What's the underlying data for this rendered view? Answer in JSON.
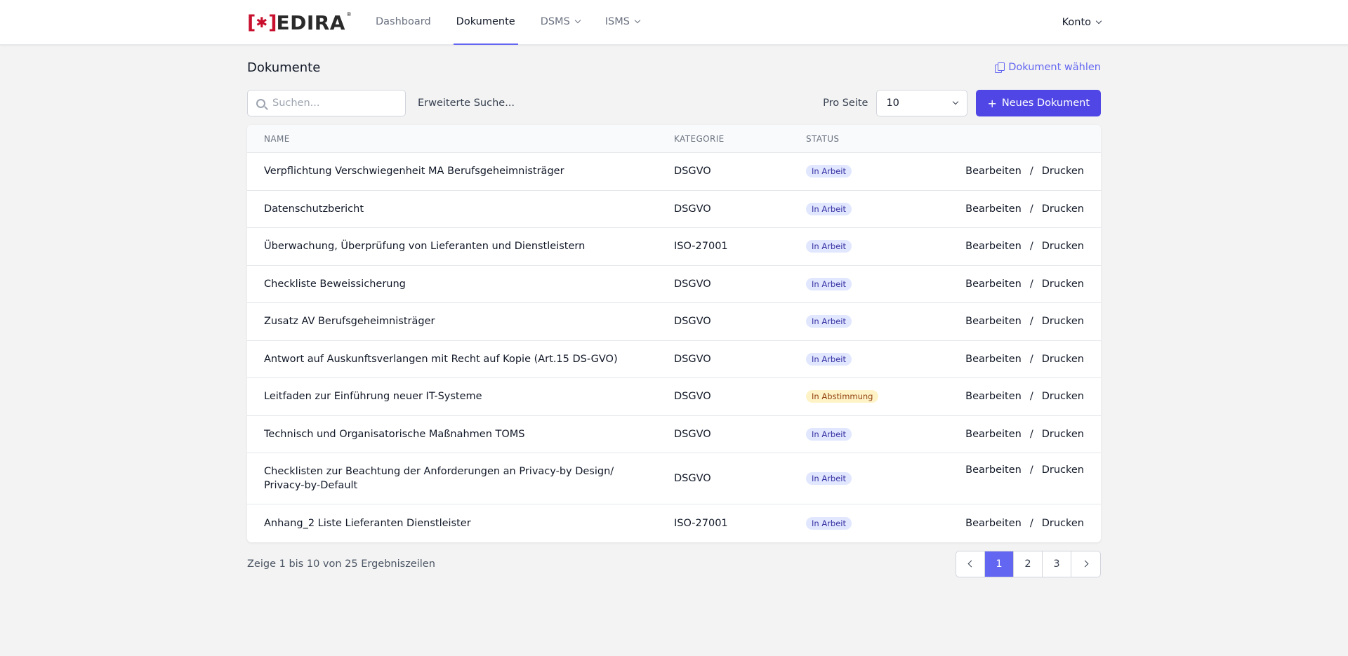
{
  "brand": {
    "bracket_open": "[",
    "bracket_close": "]",
    "star": "✱",
    "name": "EDIRA",
    "reg": "®"
  },
  "nav": {
    "items": [
      {
        "label": "Dashboard"
      },
      {
        "label": "Dokumente"
      },
      {
        "label": "DSMS"
      },
      {
        "label": "ISMS"
      }
    ],
    "account": "Konto"
  },
  "page": {
    "title": "Dokumente",
    "doc_pick": "Dokument wählen"
  },
  "toolbar": {
    "search_placeholder": "Suchen...",
    "advanced_search": "Erweiterte Suche...",
    "per_page_label": "Pro Seite",
    "per_page_value": "10",
    "new_button": "Neues Dokument",
    "new_plus": "+"
  },
  "table": {
    "headers": {
      "name": "NAME",
      "category": "KATEGORIE",
      "status": "STATUS"
    },
    "edit_label": "Bearbeiten",
    "sep": "/",
    "print_label": "Drucken",
    "rows": [
      {
        "name": "Verpflichtung Verschwiegenheit MA Berufsgeheimnisträger",
        "category": "DSGVO",
        "status": "In Arbeit"
      },
      {
        "name": "Datenschutzbericht",
        "category": "DSGVO",
        "status": "In Arbeit"
      },
      {
        "name": "Überwachung, Überprüfung von Lieferanten und Dienstleistern",
        "category": "ISO-27001",
        "status": "In Arbeit"
      },
      {
        "name": "Checkliste Beweissicherung",
        "category": "DSGVO",
        "status": "In Arbeit"
      },
      {
        "name": "Zusatz AV Berufsgeheimnisträger",
        "category": "DSGVO",
        "status": "In Arbeit"
      },
      {
        "name": "Antwort auf Auskunftsverlangen mit Recht auf Kopie (Art.15 DS-GVO)",
        "category": "DSGVO",
        "status": "In Arbeit"
      },
      {
        "name": "Leitfaden zur Einführung neuer IT-Systeme",
        "category": "DSGVO",
        "status": "In Abstimmung"
      },
      {
        "name": "Technisch und Organisatorische Maßnahmen TOMS",
        "category": "DSGVO",
        "status": "In Arbeit"
      },
      {
        "name": "Checklisten zur Beachtung der Anforderungen an Privacy-by Design/ Privacy-by-Default",
        "category": "DSGVO",
        "status": "In Arbeit"
      },
      {
        "name": "Anhang_2 Liste Lieferanten Dienstleister",
        "category": "ISO-27001",
        "status": "In Arbeit"
      }
    ]
  },
  "footer": {
    "results_text": "Zeige 1 bis 10 von 25 Ergebniszeilen",
    "pages": [
      "1",
      "2",
      "3"
    ],
    "current_page": "1"
  },
  "colors": {
    "accent": "#4f46e5",
    "active_tab_underline": "#6366f1",
    "brand_red": "#c8102e",
    "badge_in_arbeit_bg": "#e0e7ff",
    "badge_in_abstimmung_bg": "#fef3c7"
  }
}
